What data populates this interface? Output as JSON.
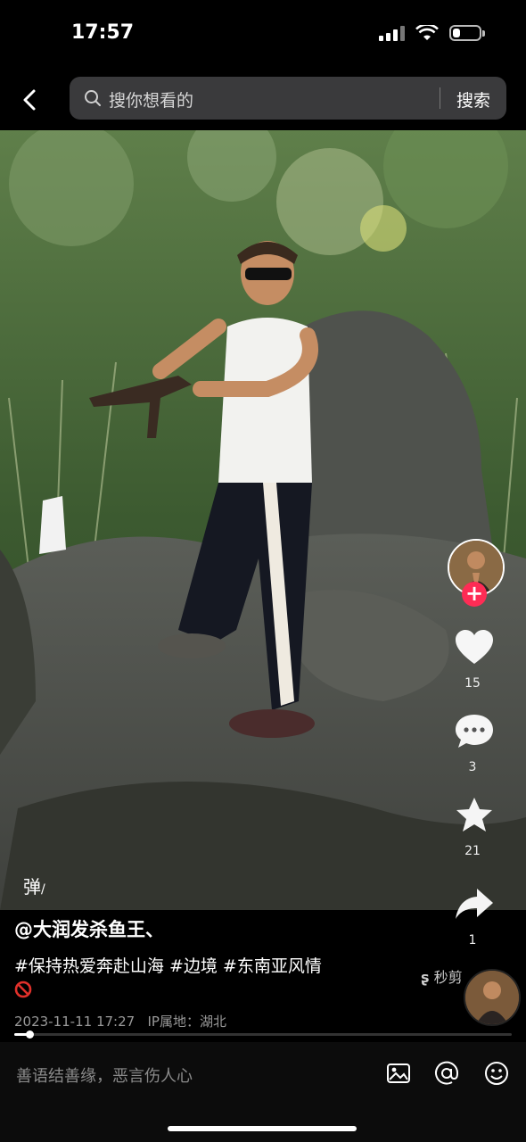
{
  "status_bar": {
    "time": "17:57"
  },
  "search": {
    "placeholder": "搜你想看的",
    "button": "搜索"
  },
  "rail": {
    "likes": "15",
    "comments": "3",
    "favorites": "21",
    "shares": "1"
  },
  "danmu_label": "弹",
  "post": {
    "author": "@大润发杀鱼王、",
    "tags": "#保持热爱奔赴山海 #边境 #东南亚风情",
    "date": "2023-11-11 17:27",
    "ip_location": "IP属地：湖北"
  },
  "jianji_label": "秒剪",
  "progress": {
    "fraction": 0.03
  },
  "comment_bar": {
    "placeholder": "善语结善缘，恶言伤人心"
  },
  "icons": [
    "back-arrow-icon",
    "search-icon",
    "heart-icon",
    "comment-icon",
    "star-icon",
    "share-icon",
    "image-icon",
    "at-icon",
    "emoji-icon",
    "prohibited-icon",
    "danmu-icon",
    "follow-plus-icon"
  ],
  "colors": {
    "follow": "#fe2c55",
    "background": "#000000",
    "search_bg": "#3a3a3c"
  }
}
